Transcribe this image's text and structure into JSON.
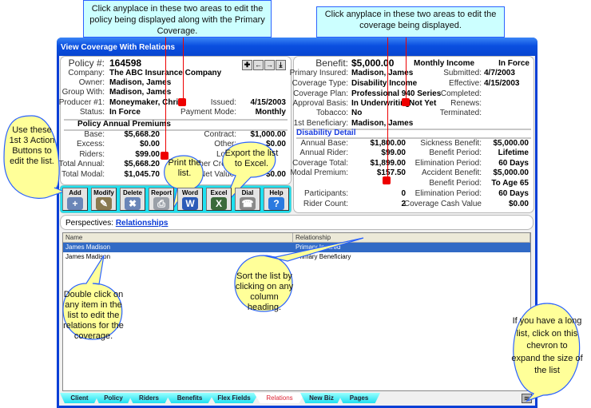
{
  "window": {
    "title": "View Coverage With Relations"
  },
  "policy": {
    "number_label": "Policy #:",
    "number": "164598",
    "nav_buttons": [
      "✚",
      "←",
      "→",
      "⤓"
    ],
    "fields": [
      {
        "label": "Company:",
        "value": "The ABC Insurance Company"
      },
      {
        "label": "Owner:",
        "value": "Madison, James"
      },
      {
        "label": "Group With:",
        "value": "Madison, James"
      },
      {
        "label": "Producer #1:",
        "value": "Moneymaker, Chris"
      },
      {
        "label": "Status:",
        "value": "In Force"
      }
    ],
    "issued_label": "Issued:",
    "issued": "4/15/2003",
    "payment_mode_label": "Payment Mode:",
    "payment_mode": "Monthly",
    "premiums_heading": "Policy Annual Premiums",
    "premiums": [
      {
        "label": "Base:",
        "value": "$5,668.20"
      },
      {
        "label": "Excess:",
        "value": "$0.00"
      },
      {
        "label": "Riders:",
        "value": "$99.00"
      },
      {
        "label": "Total Annual:",
        "value": "$5,668.20"
      },
      {
        "label": "Total Modal:",
        "value": "$1,045.70"
      }
    ],
    "premiums_right": [
      {
        "label": "Contract:",
        "value": "$1,000.00"
      },
      {
        "label": "Other:",
        "value": "$0.00"
      },
      {
        "label": "Loan:",
        "value": ""
      },
      {
        "label": "Other Credit:",
        "value": ""
      },
      {
        "label": "Net Value:",
        "value": "$0.00"
      }
    ]
  },
  "toolbar": {
    "buttons": [
      {
        "label": "Add",
        "color": "#6a86b8",
        "glyph": "+"
      },
      {
        "label": "Modify",
        "color": "#8a7a50",
        "glyph": "✎"
      },
      {
        "label": "Delete",
        "color": "#6a86b8",
        "glyph": "✖"
      },
      {
        "label": "Report",
        "color": "#9aa0a8",
        "glyph": "⎙"
      },
      {
        "label": "Word",
        "color": "#2b5bb8",
        "glyph": "W"
      },
      {
        "label": "Excel",
        "color": "#3a6a3a",
        "glyph": "X"
      },
      {
        "label": "Dial",
        "color": "#8a8a8a",
        "glyph": "☎"
      },
      {
        "label": "Help",
        "color": "#2a7ae0",
        "glyph": "?"
      }
    ]
  },
  "coverage": {
    "benefit_label": "Benefit:",
    "benefit": "$5,000.00",
    "type_title": "Monthly Income",
    "status": "In Force",
    "fields": [
      {
        "label": "Primary Insured:",
        "value": "Madison, James"
      },
      {
        "label": "Coverage Type:",
        "value": "Disability Income"
      },
      {
        "label": "Coverage Plan:",
        "value": "Professional 940 Series"
      },
      {
        "label": "Approval Basis:",
        "value": "In Underwriting"
      },
      {
        "label": "Tobacco:",
        "value": "No"
      },
      {
        "label": "1st Beneficiary:",
        "value": "Madison, James"
      }
    ],
    "approval_status": "Not Yet",
    "dates": [
      {
        "label": "Submitted:",
        "value": "4/7/2003"
      },
      {
        "label": "Effective:",
        "value": "4/15/2003"
      },
      {
        "label": "Completed:",
        "value": ""
      },
      {
        "label": "Renews:",
        "value": ""
      },
      {
        "label": "Terminated:",
        "value": ""
      }
    ],
    "detail_heading": "Disability Detail",
    "detail_left": [
      {
        "label": "Annual Base:",
        "value": "$1,800.00"
      },
      {
        "label": "Annual Rider:",
        "value": "$99.00"
      },
      {
        "label": "Coverage Total:",
        "value": "$1,899.00"
      },
      {
        "label": "Modal Premium:",
        "value": "$157.50"
      },
      {
        "label": "",
        "value": ""
      },
      {
        "label": "Participants:",
        "value": "0"
      },
      {
        "label": "Rider Count:",
        "value": "2"
      }
    ],
    "detail_right": [
      {
        "label": "Sickness Benefit:",
        "value": "$5,000.00"
      },
      {
        "label": "Benefit Period:",
        "value": "Lifetime"
      },
      {
        "label": "Elimination Period:",
        "value": "60 Days"
      },
      {
        "label": "Accident Benefit:",
        "value": "$5,000.00"
      },
      {
        "label": "Benefit Period:",
        "value": "To Age 65"
      },
      {
        "label": "Elimination Period:",
        "value": "60 Days"
      },
      {
        "label": "Coverage Cash Value",
        "value": "$0.00"
      }
    ]
  },
  "perspectives": {
    "label": "Perspectives:",
    "link": "Relationships"
  },
  "list": {
    "columns": [
      "Name",
      "Relationship"
    ],
    "rows": [
      {
        "name": "James Madison",
        "relationship": "Primary Insured",
        "selected": true
      },
      {
        "name": "James Madison",
        "relationship": "Primary Beneficiary",
        "selected": false
      }
    ]
  },
  "tabs": [
    {
      "label": "Client"
    },
    {
      "label": "Policy"
    },
    {
      "label": "Riders"
    },
    {
      "label": "Benefits"
    },
    {
      "label": "Flex Fields"
    },
    {
      "label": "Relations",
      "active": true
    },
    {
      "label": "New Biz"
    },
    {
      "label": "Pages"
    }
  ],
  "callouts": {
    "policy_note": "Click anyplace in these two areas to edit the policy being displayed along with the Primary Coverage.",
    "coverage_note": "Click anyplace in these two areas to edit the coverage being displayed.",
    "action_buttons": "Use these 1st 3 Action Buttons to edit the list.",
    "print": "Print the list.",
    "export": "Export the list to Excel.",
    "double_click": "Double click on any item in the list to edit the relations for the coverage.",
    "sort": "Sort the list by clicking on any column heading.",
    "chevron": "If you have a long list, click on this chevron to expand the size of the list"
  },
  "colors": {
    "title_bar": "#0a4fe0",
    "toolbar": "#1ee0f0",
    "selection": "#316ac5",
    "callout_fill": "#ffff99",
    "note_fill": "#ccffff",
    "marker": "#ee0000"
  }
}
